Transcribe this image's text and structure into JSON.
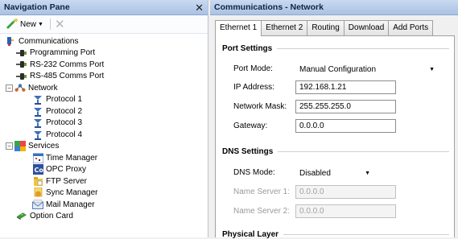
{
  "nav": {
    "title": "Navigation Pane",
    "new_label": "New",
    "tree": {
      "communications": "Communications",
      "programming_port": "Programming Port",
      "rs232": "RS-232 Comms Port",
      "rs485": "RS-485 Comms Port",
      "network": "Network",
      "protocol1": "Protocol 1",
      "protocol2": "Protocol 2",
      "protocol3": "Protocol 3",
      "protocol4": "Protocol 4",
      "services": "Services",
      "time_manager": "Time Manager",
      "opc_proxy": "OPC Proxy",
      "ftp_server": "FTP Server",
      "sync_manager": "Sync Manager",
      "mail_manager": "Mail Manager",
      "option_card": "Option Card"
    }
  },
  "panel": {
    "title": "Communications - Network",
    "tabs": [
      "Ethernet 1",
      "Ethernet 2",
      "Routing",
      "Download",
      "Add Ports"
    ],
    "port_settings": {
      "heading": "Port Settings",
      "port_mode_label": "Port Mode:",
      "port_mode_value": "Manual Configuration",
      "ip_label": "IP Address:",
      "ip_value": "192.168.1.21",
      "mask_label": "Network Mask:",
      "mask_value": "255.255.255.0",
      "gateway_label": "Gateway:",
      "gateway_value": "0.0.0.0"
    },
    "dns_settings": {
      "heading": "DNS Settings",
      "dns_mode_label": "DNS Mode:",
      "dns_mode_value": "Disabled",
      "ns1_label": "Name Server 1:",
      "ns1_value": "0.0.0.0",
      "ns2_label": "Name Server 2:",
      "ns2_value": "0.0.0.0"
    },
    "physical_layer": {
      "heading": "Physical Layer"
    }
  },
  "colors": {
    "header_bg": "#b7cdeb",
    "tree_text": "#000000",
    "disabled_text": "#9a9a9a"
  }
}
